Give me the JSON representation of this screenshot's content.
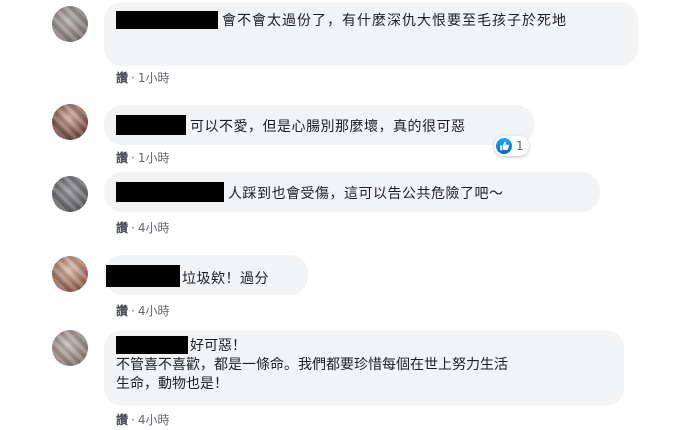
{
  "comments": [
    {
      "text": "會不會太過份了，有什麼深仇大恨要至毛孩子於死地",
      "like_label": "讚",
      "separator": "·",
      "time": "1小時"
    },
    {
      "text": "可以不愛，但是心腸別那麼壞，真的很可惡",
      "like_label": "讚",
      "separator": "·",
      "time": "1小時",
      "reaction_count": "1"
    },
    {
      "text": "人踩到也會受傷，這可以告公共危險了吧～",
      "like_label": "讚",
      "separator": "·",
      "time": "4小時"
    },
    {
      "text": "垃圾欸！過分",
      "like_label": "讚",
      "separator": "·",
      "time": "4小時"
    },
    {
      "text_line1": "好可惡！",
      "text_line2": "不管喜不喜歡，都是一條命。我們都要珍惜每個在世上努力生活",
      "text_line3": "生命，動物也是！",
      "like_label": "讚",
      "separator": "·",
      "time": "4小時"
    }
  ],
  "colors": {
    "bubble_bg": "#f2f3f5",
    "meta_text": "#606770",
    "like_blue": "#1877f2"
  },
  "icons": [
    "blurred-avatar",
    "like-thumb-icon"
  ]
}
